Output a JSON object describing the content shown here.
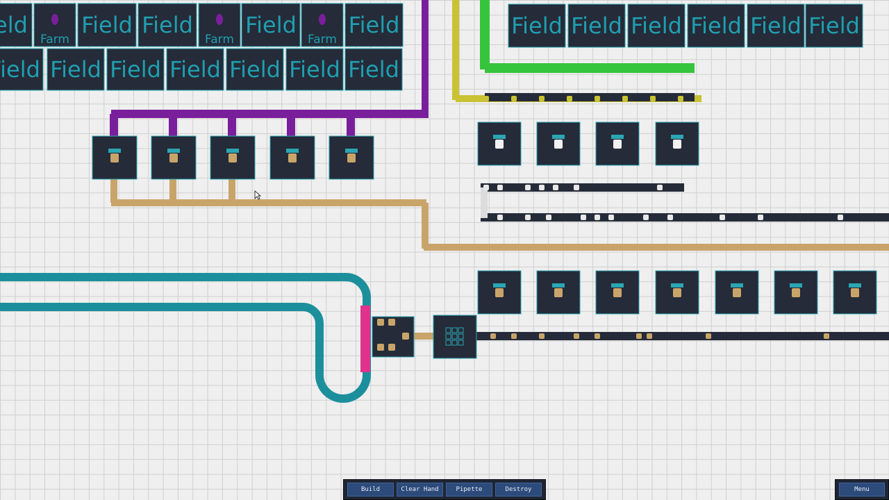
{
  "toolbar": {
    "build_label": "Build",
    "clear_hand_label": "Clear Hand",
    "pipette_label": "Pipette",
    "destroy_label": "Destroy"
  },
  "menu": {
    "label": "Menu"
  },
  "tiles": {
    "field_label": "Field",
    "farm_label": "Farm"
  },
  "icons": {
    "grape_item": "grape-icon",
    "bread_item": "bread-icon",
    "bucket_item": "milk-bucket-icon",
    "wheat_item": "wheat-icon"
  },
  "colors": {
    "background": "#efefef",
    "machine_fill": "#252b38",
    "machine_border": "#2aa6b4",
    "field_text": "#1f9fb1",
    "purple_belt": "#7a1f9c",
    "green_belt": "#36c43c",
    "yellow_belt": "#c9c232",
    "tan_item": "#c9a46a",
    "pink_item": "#e0328c",
    "teal_belt": "#1c8f9c",
    "toolbar_bg": "#1f2533",
    "button_bg": "#2c4a7a"
  }
}
